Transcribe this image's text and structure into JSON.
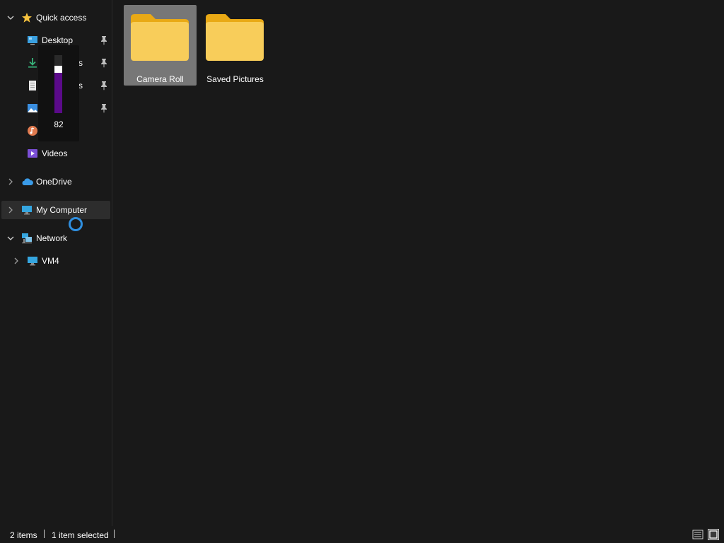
{
  "nav": {
    "quick_access": "Quick access",
    "desktop": "Desktop",
    "downloads": "s",
    "documents": "s",
    "videos": "Videos",
    "onedrive": "OneDrive",
    "my_computer": "My Computer",
    "network": "Network",
    "vm4": "VM4"
  },
  "files": [
    {
      "name": "Camera Roll",
      "selected": true
    },
    {
      "name": "Saved Pictures",
      "selected": false
    }
  ],
  "volume": {
    "value": "82",
    "level": 0.82
  },
  "status": {
    "items": "2 items",
    "selected": "1 item selected"
  },
  "colors": {
    "background": "#191919",
    "folder": "#f8c843",
    "selection": "#777777",
    "accent": "#2f8fe0",
    "volume_fill": "#5b0a8a"
  },
  "icons": [
    "star-icon",
    "desktop-icon",
    "download-icon",
    "documents-icon",
    "pictures-icon",
    "music-icon",
    "videos-icon",
    "onedrive-icon",
    "computer-icon",
    "network-icon",
    "folder-icon",
    "pin-icon",
    "details-view-icon",
    "large-icons-view-icon"
  ]
}
